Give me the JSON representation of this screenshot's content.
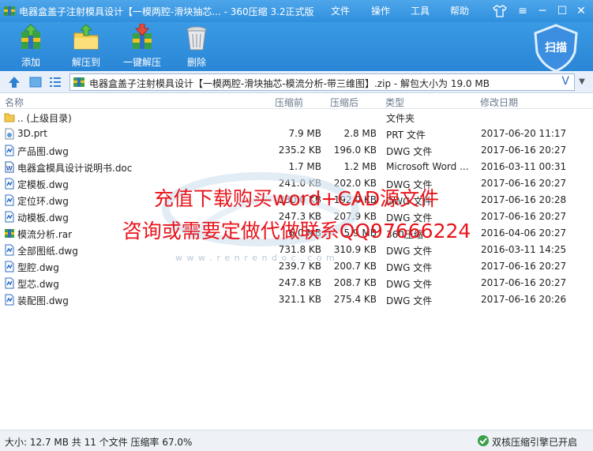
{
  "window": {
    "title": "电器盒盖子注射模具设计【一模两腔-滑块抽芯... - 360压缩 3.2正式版",
    "menus": [
      "文件",
      "操作",
      "工具",
      "帮助"
    ]
  },
  "toolbar": {
    "add": "添加",
    "extract_to": "解压到",
    "one_click_extract": "一键解压",
    "delete": "删除",
    "scan": "扫描"
  },
  "address": {
    "path": "电器盒盖子注射模具设计【一模两腔-滑块抽芯-模流分析-带三维图】.zip - 解包大小为 19.0 MB",
    "v": "V"
  },
  "columns": {
    "name": "名称",
    "size": "压缩前",
    "packed": "压缩后",
    "type": "类型",
    "modified": "修改日期"
  },
  "files": [
    {
      "name": ".. (上级目录)",
      "size": "",
      "packed": "",
      "type": "文件夹",
      "date": "",
      "icon": "folder-icon"
    },
    {
      "name": "3D.prt",
      "size": "7.9 MB",
      "packed": "2.8 MB",
      "type": "PRT 文件",
      "date": "2017-06-20 11:17",
      "icon": "file-icon"
    },
    {
      "name": "产品图.dwg",
      "size": "235.2 KB",
      "packed": "196.0 KB",
      "type": "DWG 文件",
      "date": "2017-06-16 20:27",
      "icon": "dwg-icon"
    },
    {
      "name": "电器盒模具设计说明书.doc",
      "size": "1.7 MB",
      "packed": "1.2 MB",
      "type": "Microsoft Word ...",
      "date": "2016-03-11 00:31",
      "icon": "word-icon"
    },
    {
      "name": "定模板.dwg",
      "size": "241.0 KB",
      "packed": "202.0 KB",
      "type": "DWG 文件",
      "date": "2017-06-16 20:27",
      "icon": "dwg-icon"
    },
    {
      "name": "定位环.dwg",
      "size": "230.0 KB",
      "packed": "192.0 KB",
      "type": "DWG 文件",
      "date": "2017-06-16 20:28",
      "icon": "dwg-icon"
    },
    {
      "name": "动模板.dwg",
      "size": "247.3 KB",
      "packed": "207.9 KB",
      "type": "DWG 文件",
      "date": "2017-06-16 20:27",
      "icon": "dwg-icon"
    },
    {
      "name": "模流分析.rar",
      "size": "6.0 MB",
      "packed": "5.9 MB",
      "type": "360压缩",
      "date": "2016-04-06 20:27",
      "icon": "rar-icon"
    },
    {
      "name": "全部图纸.dwg",
      "size": "731.8 KB",
      "packed": "310.9 KB",
      "type": "DWG 文件",
      "date": "2016-03-11 14:25",
      "icon": "dwg-icon"
    },
    {
      "name": "型腔.dwg",
      "size": "239.7 KB",
      "packed": "200.7 KB",
      "type": "DWG 文件",
      "date": "2017-06-16 20:27",
      "icon": "dwg-icon"
    },
    {
      "name": "型芯.dwg",
      "size": "247.8 KB",
      "packed": "208.7 KB",
      "type": "DWG 文件",
      "date": "2017-06-16 20:27",
      "icon": "dwg-icon"
    },
    {
      "name": "装配图.dwg",
      "size": "321.1 KB",
      "packed": "275.4 KB",
      "type": "DWG 文件",
      "date": "2017-06-16 20:26",
      "icon": "dwg-icon"
    }
  ],
  "overlay": {
    "line1": "充值下载购买word+CAD源文件",
    "line2": "咨询或需要定做代做联系QQ97666224",
    "site": "w w w . r e n r e n d o c . c o m"
  },
  "status": {
    "left": "大小: 12.7 MB 共 11 个文件 压缩率 67.0%",
    "right": "双核压缩引擎已开启"
  },
  "colors": {
    "accent": "#2f8fdd",
    "promo_text": "#e8141b"
  }
}
